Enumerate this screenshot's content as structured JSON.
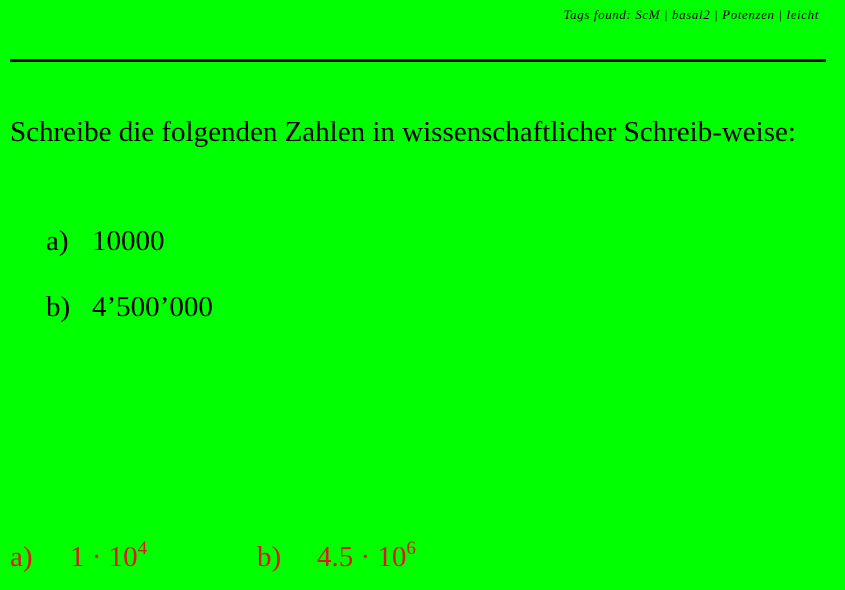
{
  "header": {
    "tags_text": "Tags found: ScM | basal2 | Potenzen | leicht"
  },
  "question": {
    "text": "Schreibe die folgenden Zahlen in wissenschaftlicher Schreib-weise:"
  },
  "items": [
    {
      "label": "a)",
      "value": "10000"
    },
    {
      "label": "b)",
      "value": "4’500’000"
    }
  ],
  "answers": [
    {
      "label": "a)",
      "mantissa": "1 · 10",
      "exponent": "4"
    },
    {
      "label": "b)",
      "mantissa": "4.5 · 10",
      "exponent": "6"
    }
  ],
  "colors": {
    "background": "#00ff00",
    "answer_text": "#e0161c",
    "text": "#000000"
  }
}
